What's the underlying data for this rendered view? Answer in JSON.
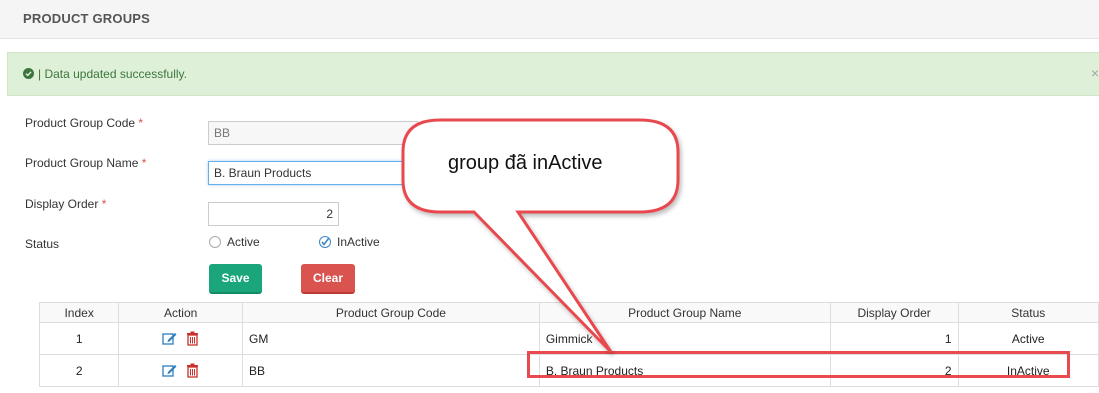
{
  "header": {
    "title": "PRODUCT GROUPS"
  },
  "alert": {
    "message": "| Data updated successfully.",
    "close_glyph": "×",
    "color": "#3c763d"
  },
  "form": {
    "code_label": "Product Group Code",
    "name_label": "Product Group Name",
    "order_label": "Display Order",
    "status_label": "Status",
    "required_mark": "*",
    "code_value": "BB",
    "name_value": "B. Braun Products",
    "order_value": "2",
    "status_options": [
      "Active",
      "InActive"
    ],
    "status_selected": "InActive"
  },
  "buttons": {
    "save": "Save",
    "clear": "Clear"
  },
  "table": {
    "headers": [
      "Index",
      "Action",
      "Product Group Code",
      "Product Group Name",
      "Display Order",
      "Status"
    ],
    "rows": [
      {
        "index": "1",
        "code": "GM",
        "name": "Gimmick",
        "order": "1",
        "status": "Active"
      },
      {
        "index": "2",
        "code": "BB",
        "name": "B. Braun Products",
        "order": "2",
        "status": "InActive"
      }
    ],
    "action_icons": [
      "edit-icon",
      "trash-icon"
    ]
  },
  "annotation": {
    "callout_text": "group đã inActive",
    "color": "#e84a4f"
  },
  "colors": {
    "save": "#1aa57a",
    "clear": "#d9534f",
    "alert_bg": "#dff0d8"
  }
}
